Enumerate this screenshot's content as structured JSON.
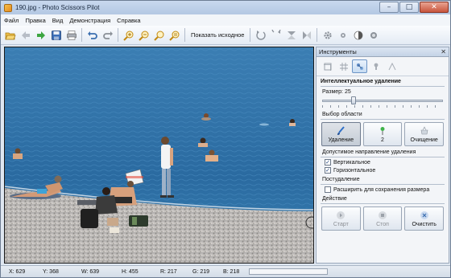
{
  "window": {
    "title": "190.jpg - Photo Scissors Pilot",
    "minimize_glyph": "–",
    "maximize_glyph": "□",
    "close_glyph": "✕"
  },
  "menu": [
    "Файл",
    "Правка",
    "Вид",
    "Демонстрация",
    "Справка"
  ],
  "toolbar": {
    "show_original_label": "Показать исходное",
    "icons": [
      "open-icon",
      "back-icon",
      "forward-icon",
      "save-icon",
      "print-icon",
      "undo-icon",
      "redo-icon",
      "zoom-in-icon",
      "zoom-out-icon",
      "zoom-fit-icon",
      "zoom-actual-icon",
      "rotate-left-icon",
      "rotate-right-icon",
      "flip-vertical-icon",
      "flip-horizontal-icon",
      "settings-icon",
      "gear-icon",
      "contrast-icon",
      "brightness-icon"
    ]
  },
  "panel": {
    "title": "Инструменты",
    "close_glyph": "✕",
    "section_title": "Интеллектуальное удаление",
    "size_label": "Размер: 25",
    "size_value": 25,
    "size_max": 100,
    "area_section": "Выбор области",
    "area_buttons": [
      {
        "label": "Удаление",
        "icon": "brush-icon",
        "active": true
      },
      {
        "label": "2",
        "icon": "green-pin-icon",
        "active": false
      },
      {
        "label": "Очищение",
        "icon": "eraser-icon",
        "active": false
      }
    ],
    "direction_section": "Допустимое направление удаления",
    "vertical_label": "Вертикальное",
    "vertical_checked": true,
    "horizontal_label": "Горизонтальное",
    "horizontal_checked": true,
    "insertion_section": "Постудаление",
    "expand_label": "Расширить для сохранения размера",
    "expand_checked": false,
    "action_section": "Действие",
    "action_buttons": [
      {
        "label": "Старт",
        "icon": "play-icon",
        "disabled": true
      },
      {
        "label": "Стоп",
        "icon": "stop-icon",
        "disabled": true
      },
      {
        "label": "Очистить",
        "icon": "clear-icon",
        "disabled": false
      }
    ]
  },
  "status": {
    "x": "X: 629",
    "y": "Y: 368",
    "w": "W: 639",
    "h": "H: 455",
    "r": "R: 217",
    "g": "G: 219",
    "b": "B: 218"
  },
  "colors": {
    "sea": "#2d6fa3",
    "pebbles": "#a8a6a4",
    "accent": "#6d95c6"
  }
}
